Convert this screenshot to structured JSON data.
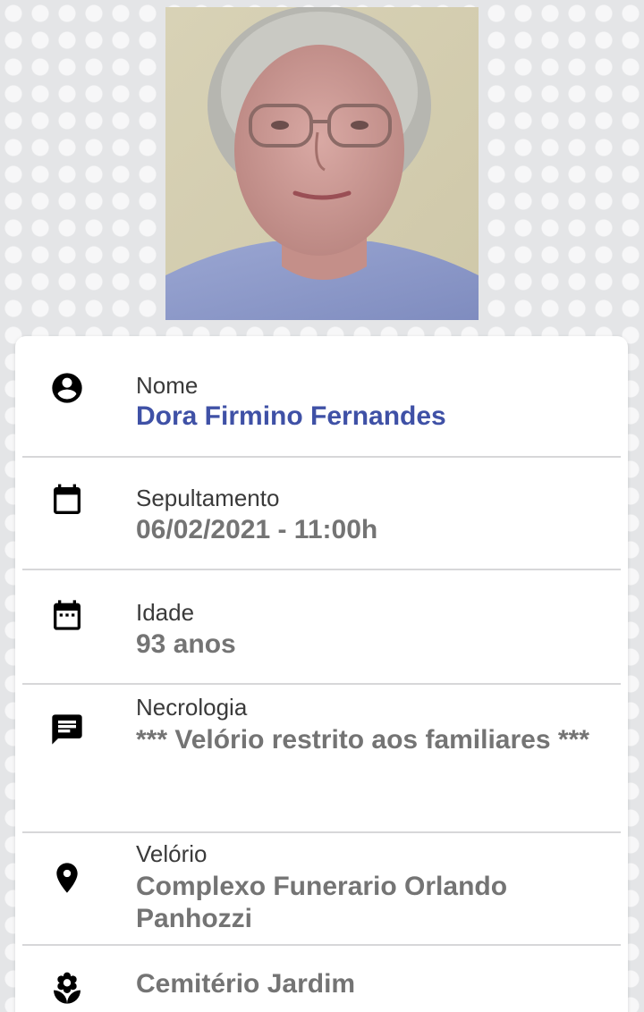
{
  "photo": {
    "icon": "portrait-photo"
  },
  "fields": [
    {
      "icon": "account-circle-icon",
      "label": "Nome",
      "value": "Dora Firmino Fernandes"
    },
    {
      "icon": "calendar-icon",
      "label": "Sepultamento",
      "value": "06/02/2021 - 11:00h"
    },
    {
      "icon": "calendar-dots-icon",
      "label": "Idade",
      "value": "93 anos"
    },
    {
      "icon": "message-icon",
      "label": "Necrologia",
      "value": "*** Velório restrito aos familiares ***"
    },
    {
      "icon": "location-pin-icon",
      "label": "Velório",
      "value": "Complexo Funerario Orlando Panhozzi"
    },
    {
      "icon": "flower-icon",
      "label": "",
      "value": "Cemitério Jardim"
    }
  ],
  "colors": {
    "name_value": "#3f51a6",
    "value": "#747474",
    "label": "#3a3a3a",
    "icon": "#000000"
  }
}
